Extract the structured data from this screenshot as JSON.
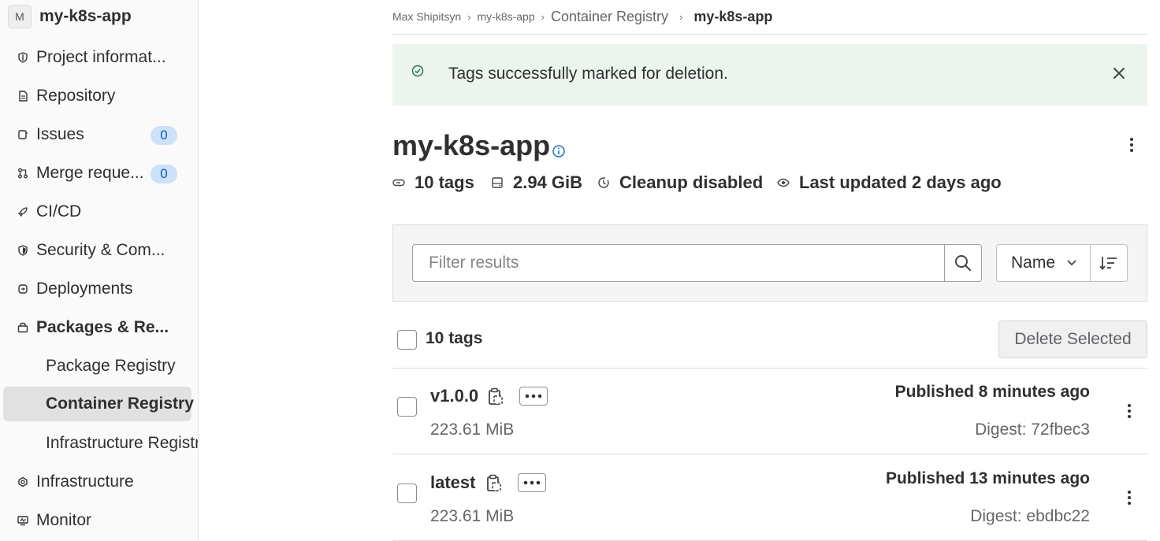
{
  "sidebar": {
    "avatar_letter": "M",
    "project_name": "my-k8s-app",
    "items": [
      {
        "label": "Project informat...",
        "icon": "info-shield-icon"
      },
      {
        "label": "Repository",
        "icon": "doc-icon"
      },
      {
        "label": "Issues",
        "icon": "issues-icon",
        "badge": "0"
      },
      {
        "label": "Merge reque...",
        "icon": "merge-request-icon",
        "badge": "0"
      },
      {
        "label": "CI/CD",
        "icon": "rocket-icon"
      },
      {
        "label": "Security & Com...",
        "icon": "shield-icon"
      },
      {
        "label": "Deployments",
        "icon": "deployments-icon"
      },
      {
        "label": "Packages & Re...",
        "icon": "package-icon"
      },
      {
        "label": "Infrastructure",
        "icon": "cloud-gear-icon"
      },
      {
        "label": "Monitor",
        "icon": "monitor-icon"
      }
    ],
    "sub_items": [
      {
        "label": "Package Registry"
      },
      {
        "label": "Container Registry"
      },
      {
        "label": "Infrastructure Registry"
      }
    ]
  },
  "breadcrumb": {
    "items": [
      "Max Shipitsyn",
      "my-k8s-app",
      "Container Registry",
      "my-k8s-app"
    ]
  },
  "alert": {
    "text": "Tags successfully marked for deletion."
  },
  "header": {
    "title": "my-k8s-app",
    "tags": "10 tags",
    "size": "2.94 GiB",
    "cleanup": "Cleanup disabled",
    "updated": "Last updated 2 days ago"
  },
  "filter": {
    "placeholder": "Filter results",
    "sort_label": "Name"
  },
  "list": {
    "count_label": "10 tags",
    "delete_label": "Delete Selected",
    "rows": [
      {
        "name": "v1.0.0",
        "size": "223.61 MiB",
        "published": "Published 8 minutes ago",
        "digest": "Digest: 72fbec3"
      },
      {
        "name": "latest",
        "size": "223.61 MiB",
        "published": "Published 13 minutes ago",
        "digest": "Digest: ebdbc22"
      }
    ]
  },
  "colors": {
    "alert_bg": "#ecf4ee",
    "success": "#217645",
    "badge_bg": "#cbe2f9",
    "badge_text": "#0b5cad",
    "info": "#1f75cb"
  }
}
